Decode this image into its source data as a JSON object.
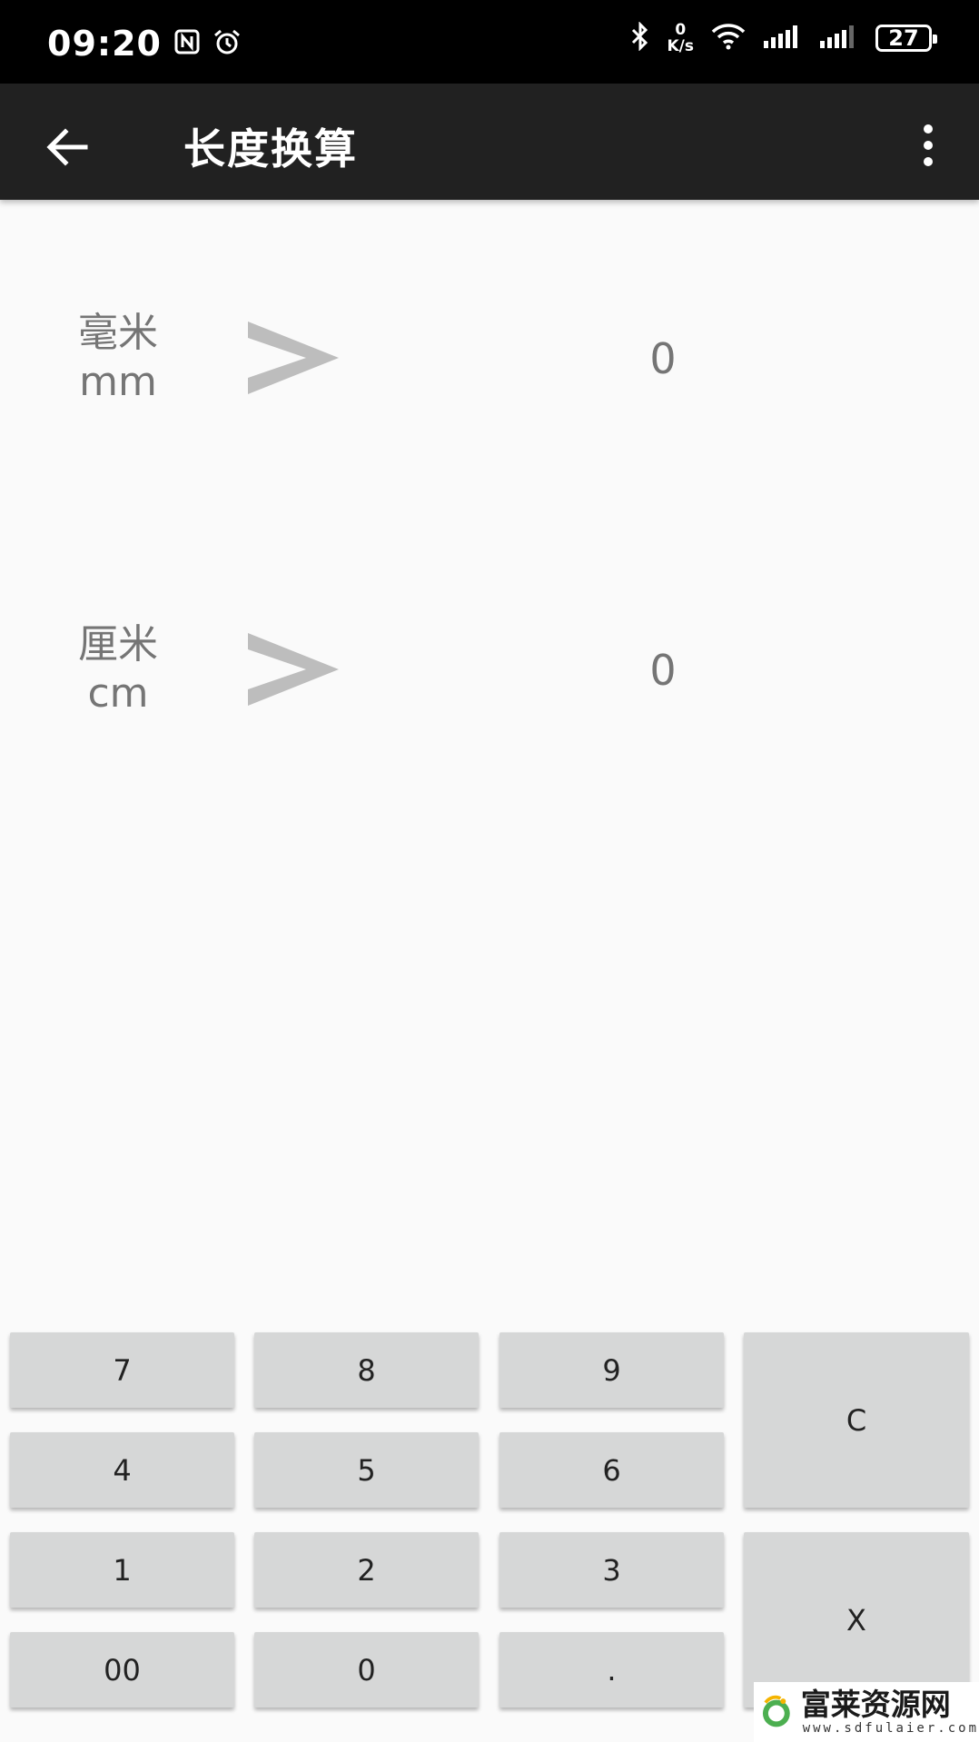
{
  "status_bar": {
    "time": "09:20",
    "speed_value": "0",
    "speed_unit": "K/s",
    "battery": "27",
    "icons": [
      "nfc-icon",
      "alarm-icon",
      "bluetooth-icon",
      "wifi-icon",
      "signal-icon",
      "signal-icon",
      "battery-icon"
    ]
  },
  "app_bar": {
    "title": "长度换算",
    "icons": [
      "back-arrow-icon",
      "more-vert-icon"
    ]
  },
  "conversions": [
    {
      "unit_name": "毫米",
      "unit_abbr": "mm",
      "arrow": ">",
      "value": "0"
    },
    {
      "unit_name": "厘米",
      "unit_abbr": "cm",
      "arrow": ">",
      "value": "0"
    }
  ],
  "keypad": {
    "k7": "7",
    "k8": "8",
    "k9": "9",
    "clear": "C",
    "k4": "4",
    "k5": "5",
    "k6": "6",
    "k1": "1",
    "k2": "2",
    "k3": "3",
    "delete": "X",
    "k00": "00",
    "k0": "0",
    "dot": "."
  },
  "watermark": {
    "name": "富莱资源网",
    "url": "www.sdfulaier.com"
  },
  "colors": {
    "status_bar": "#000000",
    "app_bar": "#212121",
    "background": "#fafafa",
    "key": "#d6d7d7",
    "label_text": "#757575",
    "arrow": "#bdbdbd"
  }
}
